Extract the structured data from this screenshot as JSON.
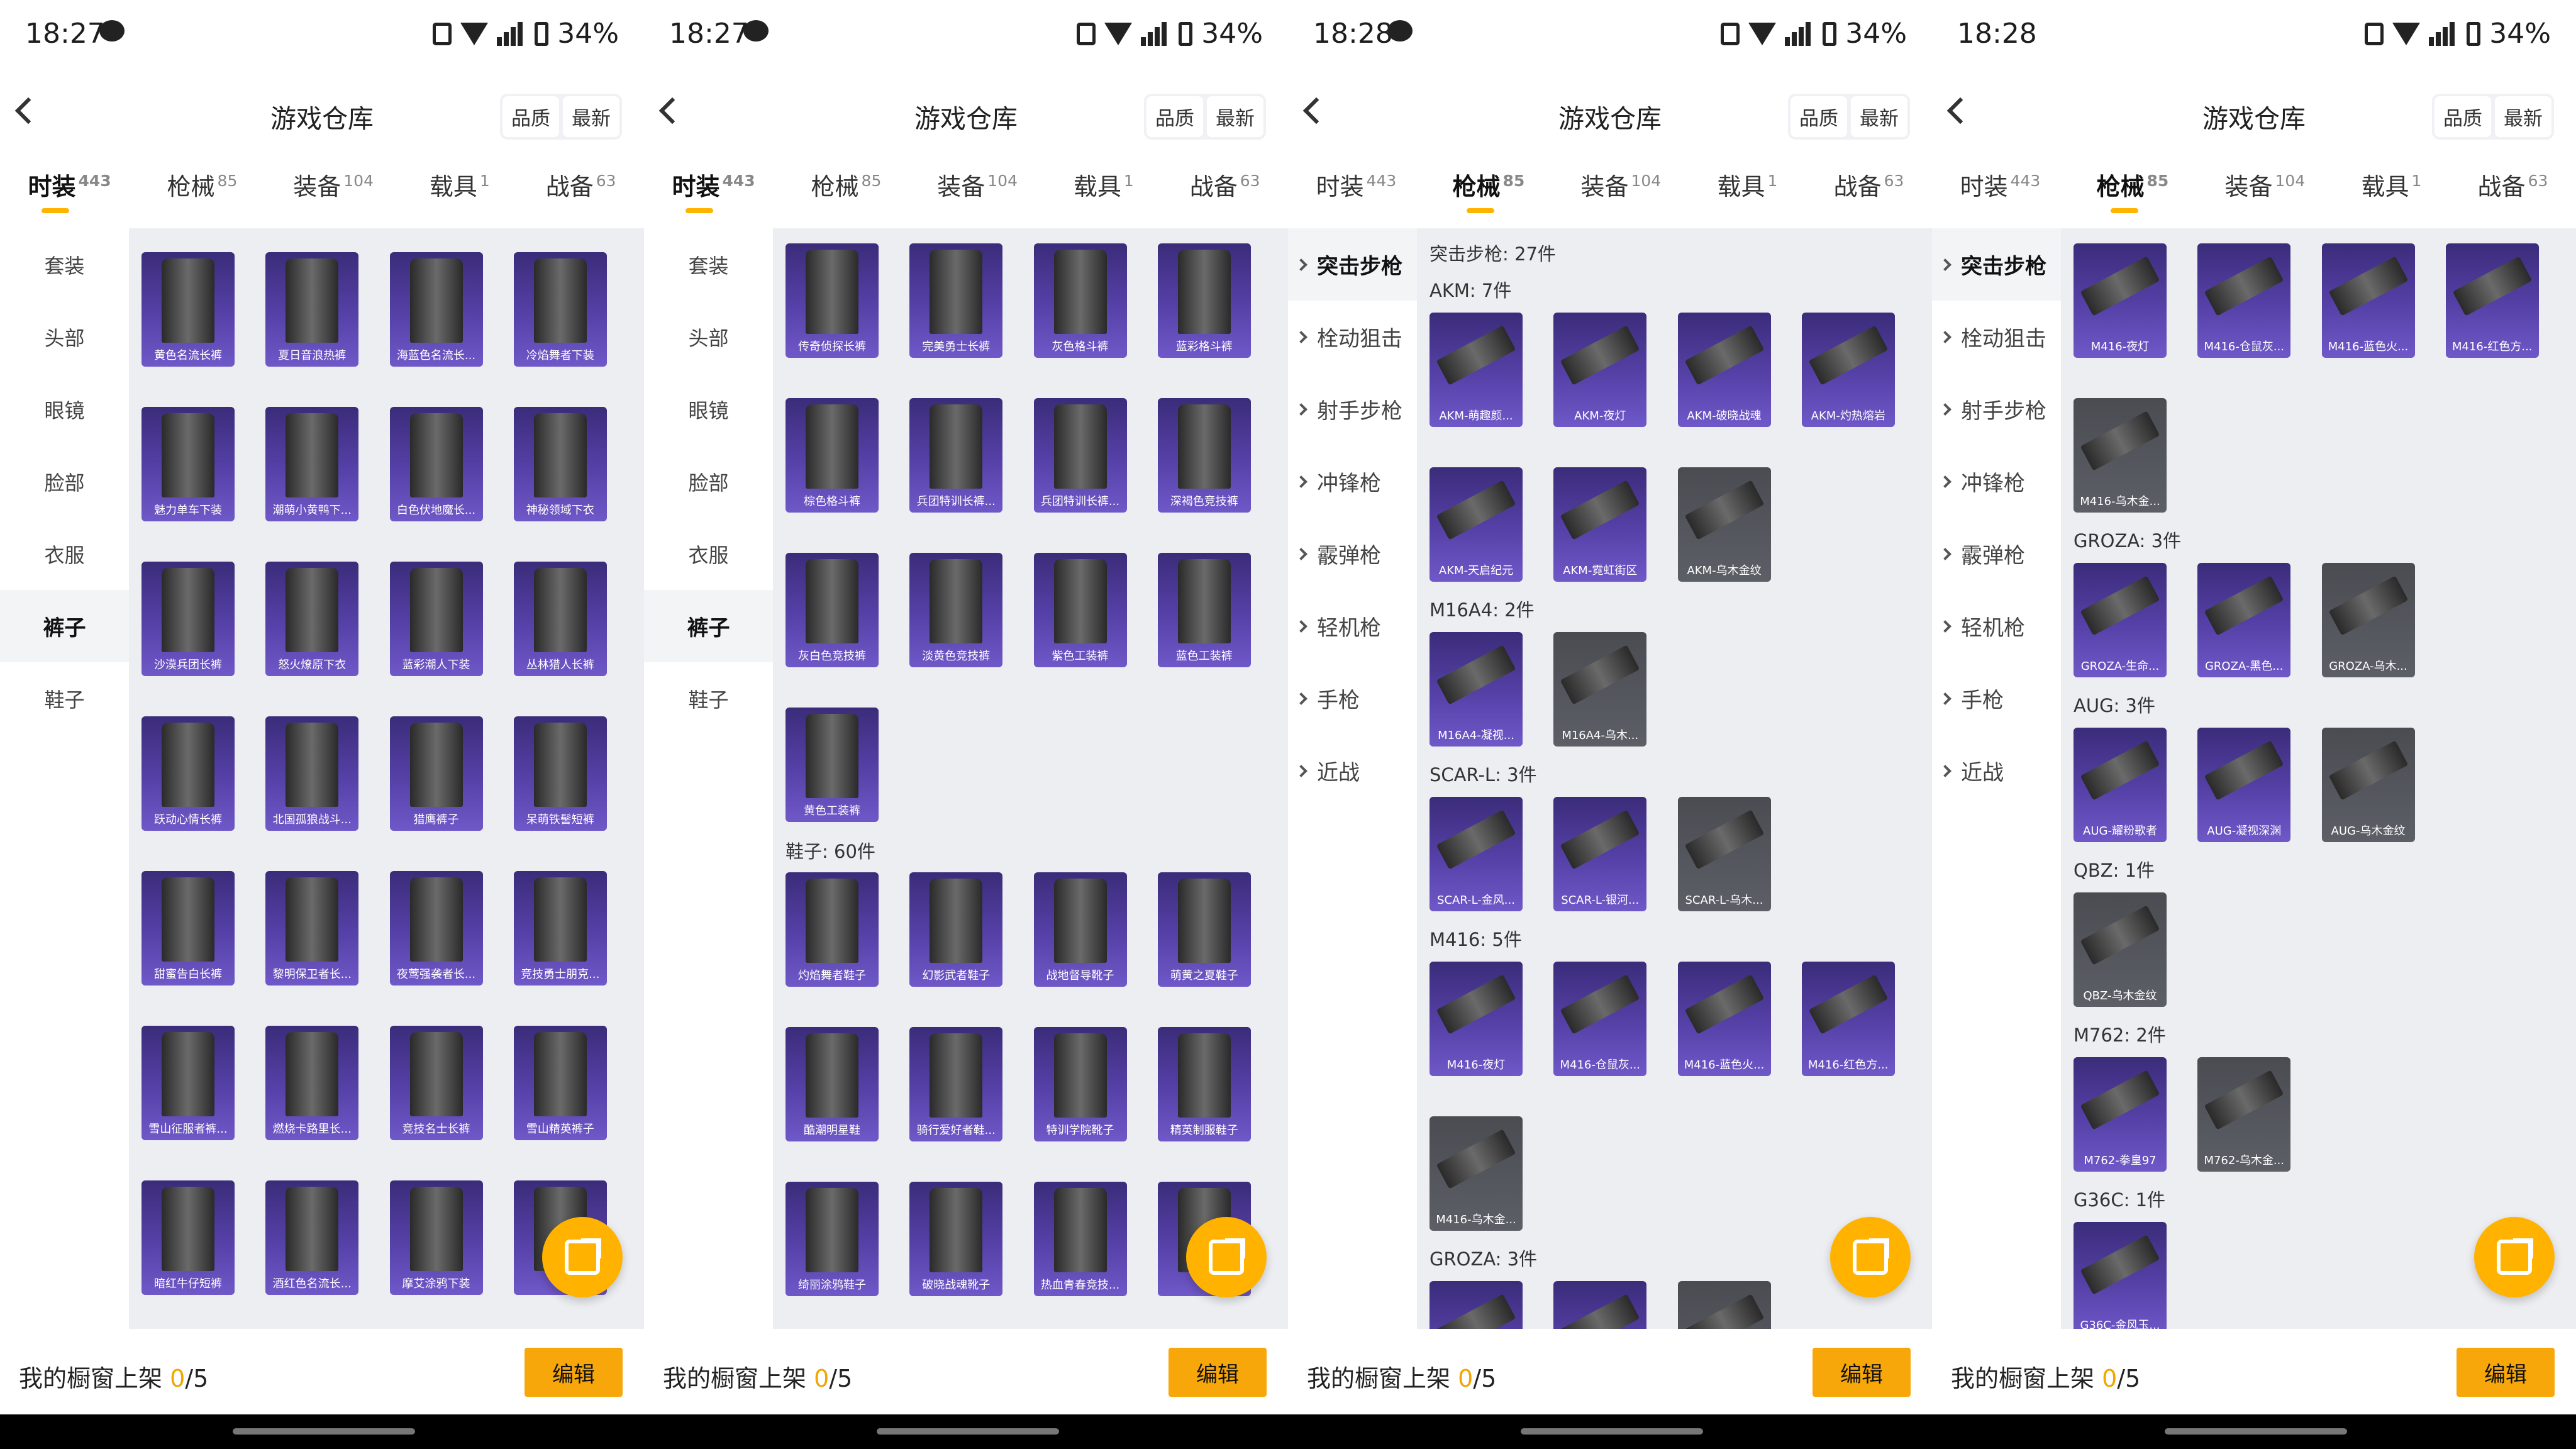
{
  "panels": [
    {
      "status_time": "18:27",
      "battery": "34%",
      "title": "游戏仓库",
      "sort_quality": "品质",
      "sort_latest": "最新",
      "active_tab": 0
    },
    {
      "status_time": "18:27",
      "battery": "34%",
      "title": "游戏仓库",
      "sort_quality": "品质",
      "sort_latest": "最新",
      "active_tab": 0
    },
    {
      "status_time": "18:28",
      "battery": "34%",
      "title": "游戏仓库",
      "sort_quality": "品质",
      "sort_latest": "最新",
      "active_tab": 1
    },
    {
      "status_time": "18:28",
      "battery": "34%",
      "title": "游戏仓库",
      "sort_quality": "品质",
      "sort_latest": "最新",
      "active_tab": 1
    }
  ],
  "tabs": [
    {
      "label": "时装",
      "count": "443"
    },
    {
      "label": "枪械",
      "count": "85"
    },
    {
      "label": "装备",
      "count": "104"
    },
    {
      "label": "载具",
      "count": "1"
    },
    {
      "label": "战备",
      "count": "63"
    }
  ],
  "outfit_categories": [
    "套装",
    "头部",
    "眼镜",
    "脸部",
    "衣服",
    "裤子",
    "鞋子"
  ],
  "gun_categories": [
    "突击步枪",
    "栓动狙击",
    "射手步枪",
    "冲锋枪",
    "霰弹枪",
    "轻机枪",
    "手枪",
    "近战"
  ],
  "panel1_items": [
    "黄色名流长裤",
    "夏日音浪热裤",
    "海蓝色名流长...",
    "冷焰舞者下装",
    "魅力单车下装",
    "潮萌小黄鸭下...",
    "白色伏地魔长...",
    "神秘领域下衣",
    "沙漠兵团长裤",
    "怒火燎原下衣",
    "蓝彩潮人下装",
    "丛林猎人长裤",
    "跃动心情长裤",
    "北国孤狼战斗...",
    "猎鹰裤子",
    "呆萌铁髻短裤",
    "甜蜜告白长裤",
    "黎明保卫者长...",
    "夜莺强袭者长...",
    "竞技勇士朋克...",
    "雪山征服者裤...",
    "燃烧卡路里长...",
    "竞技名士长裤",
    "雪山精英裤子",
    "暗红牛仔短裤",
    "酒红色名流长...",
    "摩艾涂鸦下装",
    ""
  ],
  "panel2_pants": [
    "传奇侦探长裤",
    "完美勇士长裤",
    "灰色格斗裤",
    "蓝彩格斗裤",
    "棕色格斗裤",
    "兵团特训长裤...",
    "兵团特训长裤...",
    "深褐色竞技裤",
    "灰白色竞技裤",
    "淡黄色竞技裤",
    "紫色工装裤",
    "蓝色工装裤",
    "黄色工装裤"
  ],
  "panel2_shoes_header": "鞋子: 60件",
  "panel2_shoes": [
    "灼焰舞者鞋子",
    "幻影武者鞋子",
    "战地督导靴子",
    "萌黄之夏鞋子",
    "酷潮明星鞋",
    "骑行爱好者鞋...",
    "特训学院靴子",
    "精英制服鞋子",
    "绮丽涂鸦鞋子",
    "破晓战魂靴子",
    "热血青春竞技...",
    ""
  ],
  "panel3_sections": [
    {
      "header": "突击步枪: 27件",
      "items": []
    },
    {
      "header": "AKM: 7件",
      "items": [
        "AKM-萌趣颜...",
        "AKM-夜灯",
        "AKM-破晓战魂",
        "AKM-灼热熔岩",
        "AKM-天启纪元",
        "AKM-霓虹街区",
        "AKM-乌木金纹"
      ],
      "grey": [
        6
      ]
    },
    {
      "header": "M16A4: 2件",
      "items": [
        "M16A4-凝视...",
        "M16A4-乌木..."
      ],
      "grey": [
        1
      ]
    },
    {
      "header": "SCAR-L: 3件",
      "items": [
        "SCAR-L-金风...",
        "SCAR-L-银河...",
        "SCAR-L-乌木..."
      ],
      "grey": [
        2
      ]
    },
    {
      "header": "M416: 5件",
      "items": [
        "M416-夜灯",
        "M416-仓鼠灰...",
        "M416-蓝色火...",
        "M416-红色方...",
        "M416-乌木金..."
      ],
      "grey": [
        4
      ]
    },
    {
      "header": "GROZA: 3件",
      "items": [
        "",
        "",
        ""
      ],
      "grey": [
        2
      ]
    }
  ],
  "panel4_sections": [
    {
      "header": "",
      "items": [
        "M416-夜灯",
        "M416-仓鼠灰...",
        "M416-蓝色火...",
        "M416-红色方...",
        "M416-乌木金..."
      ],
      "grey": [
        4
      ]
    },
    {
      "header": "GROZA: 3件",
      "items": [
        "GROZA-生命...",
        "GROZA-黑色...",
        "GROZA-乌木..."
      ],
      "grey": [
        2
      ]
    },
    {
      "header": "AUG: 3件",
      "items": [
        "AUG-耀粉歌者",
        "AUG-凝视深渊",
        "AUG-乌木金纹"
      ],
      "grey": [
        2
      ]
    },
    {
      "header": "QBZ: 1件",
      "items": [
        "QBZ-乌木金纹"
      ],
      "grey": [
        0
      ]
    },
    {
      "header": "M762: 2件",
      "items": [
        "M762-拳皇97",
        "M762-乌木金..."
      ],
      "grey": [
        1
      ]
    },
    {
      "header": "G36C: 1件",
      "items": [
        "G36C-金风玉..."
      ],
      "grey": []
    }
  ],
  "bottom": {
    "label": "我的橱窗上架 ",
    "count": "0",
    "total": "/5",
    "edit": "编辑"
  },
  "colors": {
    "accent": "#f7a70a",
    "card_purple": "#5641a8",
    "card_grey": "#55575d"
  }
}
